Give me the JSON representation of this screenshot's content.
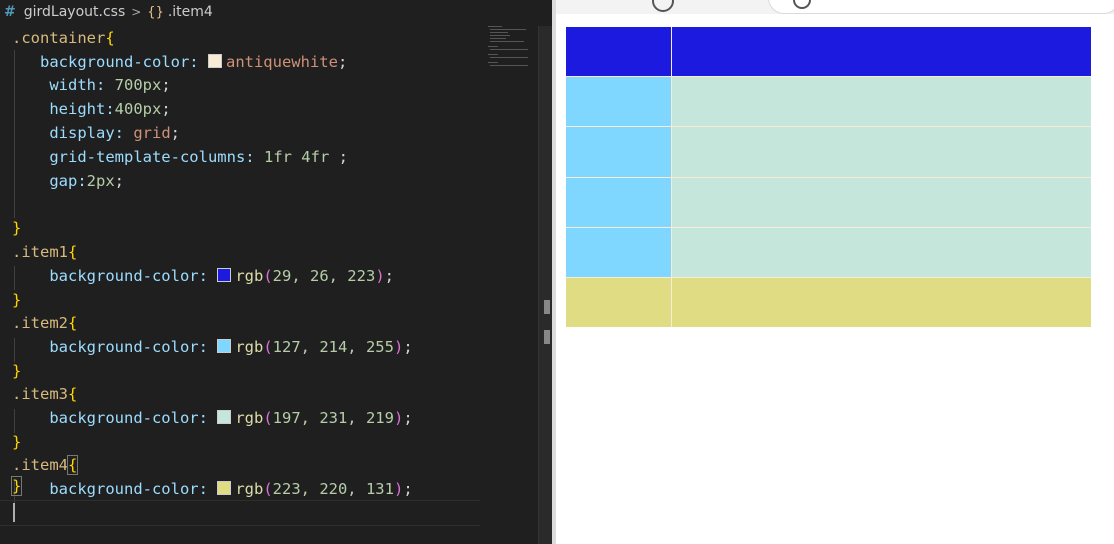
{
  "breadcrumb": {
    "hash": "#",
    "file": "girdLayout.css",
    "separator": ">",
    "symbol_icon": "{}",
    "symbol": ".item4"
  },
  "code": {
    "container_selector": ".container",
    "bg_prop": "background-color:",
    "bg_value": "antiquewhite",
    "width_prop": "width:",
    "width_value": "700px",
    "height_prop": "height:",
    "height_value": "400px",
    "display_prop": "display:",
    "display_value": "grid",
    "gtc_prop": "grid-template-columns:",
    "gtc_value": "1fr 4fr",
    "gap_prop": "gap:",
    "gap_value": "2px",
    "item1_selector": ".item1",
    "item1_rgb": "29, 26, 223",
    "item2_selector": ".item2",
    "item2_rgb": "127, 214, 255",
    "item3_selector": ".item3",
    "item3_rgb": "197, 231, 219",
    "item4_selector": ".item4",
    "item4_rgb": "223, 220, 131"
  },
  "colors": {
    "antiquewhite": "#faebd7",
    "item1": "#1d1adf",
    "item2": "#7fd6ff",
    "item3": "#c5e7db",
    "item4": "#dfdc83"
  },
  "grid": {
    "rows": [
      [
        "item1",
        "item1"
      ],
      [
        "item2",
        "item3"
      ],
      [
        "item2",
        "item3"
      ],
      [
        "item2",
        "item3"
      ],
      [
        "item2",
        "item3"
      ],
      [
        "item4",
        "item4"
      ]
    ]
  }
}
